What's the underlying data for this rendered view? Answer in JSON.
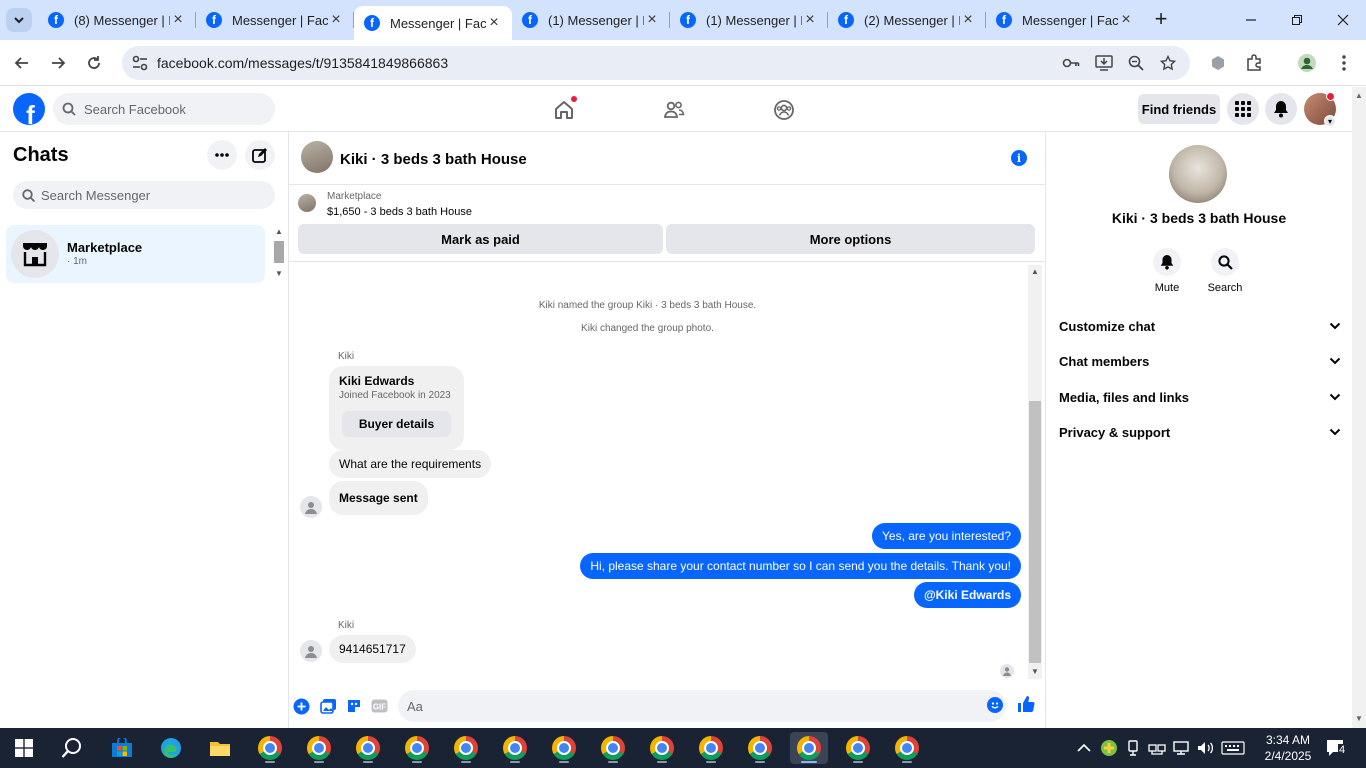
{
  "browser": {
    "tabs": [
      {
        "title": "(8) Messenger | F",
        "active": false
      },
      {
        "title": "Messenger | Face",
        "active": false
      },
      {
        "title": "Messenger | Face",
        "active": true
      },
      {
        "title": "(1) Messenger | F",
        "active": false
      },
      {
        "title": "(1) Messenger | F",
        "active": false
      },
      {
        "title": "(2) Messenger | F",
        "active": false
      },
      {
        "title": "Messenger | Face",
        "active": false
      }
    ],
    "url": "facebook.com/messages/t/9135841849866863"
  },
  "fb_header": {
    "search_placeholder": "Search Facebook",
    "find_friends": "Find friends"
  },
  "left": {
    "title": "Chats",
    "search_placeholder": "Search Messenger",
    "chats": [
      {
        "name": "Marketplace",
        "time": "· 1m"
      }
    ]
  },
  "conversation": {
    "title": "Kiki · 3 beds 3 bath House",
    "marketplace_label": "Marketplace",
    "listing": "$1,650 - 3 beds 3 bath House",
    "mark_paid": "Mark as paid",
    "more_options": "More options",
    "system_messages": [
      "Kiki named the group Kiki · 3 beds 3 bath House.",
      "Kiki changed the group photo."
    ],
    "sender_1": "Kiki",
    "card": {
      "name": "Kiki Edwards",
      "subtitle": "Joined Facebook in 2023",
      "button": "Buyer details"
    },
    "incoming_1": "What are the requirements",
    "incoming_2": "Message sent",
    "outgoing": [
      "Yes, are you interested?",
      "Hi, please share your contact number so I can send you the details. Thank you!",
      "@Kiki Edwards"
    ],
    "sender_2": "Kiki",
    "incoming_3": "9414651717",
    "composer_placeholder": "Aa"
  },
  "right": {
    "title": "Kiki · 3 beds 3 bath House",
    "actions": [
      "Mute",
      "Search"
    ],
    "sections": [
      "Customize chat",
      "Chat members",
      "Media, files and links",
      "Privacy & support"
    ]
  },
  "taskbar": {
    "time": "3:34 AM",
    "date": "2/4/2025",
    "notifications": "4"
  },
  "colors": {
    "facebook_blue": "#0866ff",
    "selected_chat": "#ebf5ff",
    "taskbar": "#1a2334"
  }
}
